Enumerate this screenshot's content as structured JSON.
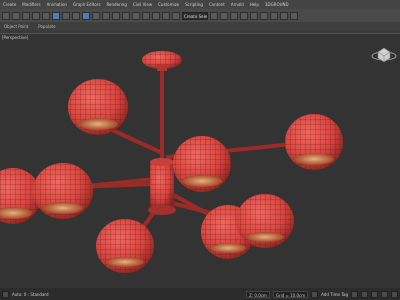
{
  "menu": [
    "Create",
    "Modifiers",
    "Animation",
    "Graph Editors",
    "Rendering",
    "Civil View",
    "Customize",
    "Scripting",
    "Content",
    "Arnold",
    "Help",
    "3DGROUND"
  ],
  "toolbar": {
    "selection_set_value": "Create Selection Se"
  },
  "ribbon": {
    "tabs": [
      "Object Paint",
      "Populate"
    ]
  },
  "viewport": {
    "label": "[Perspective]"
  },
  "status": {
    "left_text": "Auto: 0 : Standard",
    "coords": "Z: 0.0cm",
    "grid": "Grid = 10.0cm",
    "addtime": "Add Time Tag"
  },
  "colors": {
    "shade": "#d8453f",
    "wire": "#6b1717",
    "bg": "#333333",
    "accent": "#4b7fb8"
  },
  "icons": [
    "undo-icon",
    "redo-icon",
    "link-icon",
    "select-icon",
    "move-icon",
    "rotate-icon",
    "scale-icon",
    "snap-icon",
    "render-icon",
    "viewcube-icon",
    "play-icon"
  ]
}
